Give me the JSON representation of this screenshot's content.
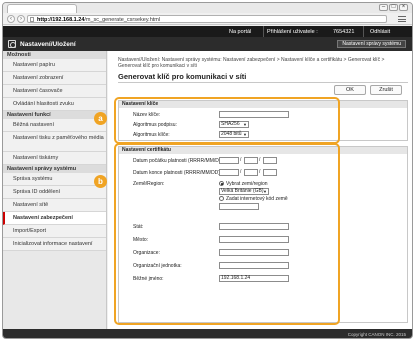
{
  "browser": {
    "url_host": "http://192.168.1.24",
    "url_path": "/m_sc_generate_csrsekey.html",
    "back_icon": "back-arrow-icon",
    "forward_icon": "forward-arrow-icon"
  },
  "topbar": {
    "portal": "Na portál",
    "login_user_label": "Přihlášení uživatele :",
    "login_user_value": "7654321",
    "logout": "Odhlásit"
  },
  "header": {
    "title": "Nastavení/Uložení",
    "system_button": "Nastavení správy systému"
  },
  "sidebar": {
    "sections": [
      {
        "title": "Možnosti",
        "items": [
          "Nastavení papíru",
          "Nastavení zobrazení",
          "Nastavení časovače",
          "Ovládání hlasitosti zvuku"
        ]
      },
      {
        "title": "Nastavení funkcí",
        "items": [
          "Běžná nastavení",
          "Nastavení tisku z paměťového média",
          "Nastavení tiskárny"
        ]
      },
      {
        "title": "Nastavení správy systému",
        "items": [
          "Správa systému",
          "Správa ID oddělení",
          "Nastavení sítě",
          "Nastavení zabezpečení",
          "Import/Export",
          "Inicializovat informace nastavení"
        ]
      }
    ]
  },
  "main": {
    "breadcrumb": "Nastavení/Uložení: Nastavení správy systému: Nastavení zabezpečení > Nastavení klíče a certifikátu > Generovat klíč > Generovat klíč pro komunikaci v síti",
    "title": "Generovat klíč pro komunikaci v síti",
    "ok_button": "OK",
    "cancel_button": "Zrušit",
    "key_group": {
      "heading": "Nastavení klíče",
      "key_name_label": "Název klíče:",
      "key_name_value": "",
      "sig_alg_label": "Algoritmus podpisu:",
      "sig_alg_value": "SHA256",
      "key_alg_label": "Algoritmus klíče:",
      "key_alg_value": "2048 bitů"
    },
    "cert_group": {
      "heading": "Nastavení certifikátu",
      "valid_from_label": "Datum počátku platnosti (RRRR/MM/DD):",
      "valid_to_label": "Datum konce platnosti (RRRR/MM/DD):",
      "country_label": "Země/Region:",
      "radio_choose": "Vybrat zemi/region",
      "country_value": "Velká Británie (GB)",
      "radio_enter": "Zadat internetový kód země",
      "state_label": "Stát:",
      "city_label": "Město:",
      "org_label": "Organizace:",
      "unit_label": "Organizační jednotka:",
      "common_name_label": "Běžné jméno:",
      "common_name_value": "192.168.1.24"
    },
    "callouts": [
      "a",
      "b"
    ]
  },
  "footer": {
    "copyright": "Copyright CANON INC. 2015"
  }
}
